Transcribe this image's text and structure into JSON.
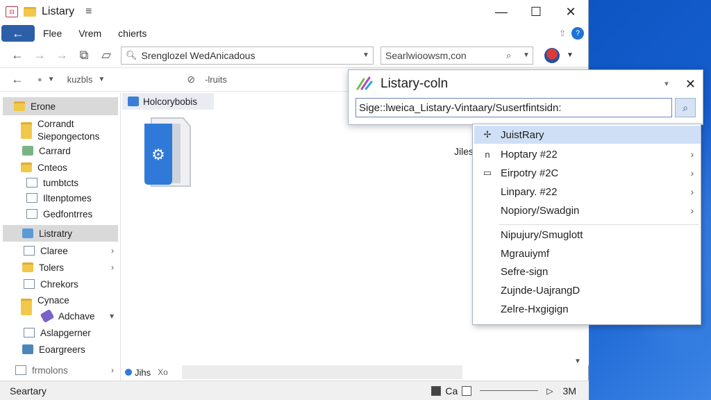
{
  "window": {
    "title": "Listary",
    "menu_glyph": "≡",
    "minimize": "—",
    "maximize": "☐",
    "close": "✕"
  },
  "menubar": {
    "items": [
      "Flee",
      "Vrem",
      "chierts"
    ]
  },
  "address": {
    "path": "Srenglozel WedAnicadous",
    "search_placeholder": "Searlwioowsm,con"
  },
  "toolbar2": {
    "label1": "kuzbls",
    "label2": "-lruits"
  },
  "sidebar": {
    "items": [
      {
        "label": "Erone"
      },
      {
        "label": "Corrandt"
      },
      {
        "label": "Siepongectons"
      },
      {
        "label": "Carrard"
      },
      {
        "label": "Cnteos"
      },
      {
        "label": "tumbtcts"
      },
      {
        "label": "Iltenptomes"
      },
      {
        "label": "Gedfontrres"
      },
      {
        "label": "Listratry"
      },
      {
        "label": "Claree"
      },
      {
        "label": "Tolers"
      },
      {
        "label": "Chrekors"
      },
      {
        "label": "Cynace"
      },
      {
        "label": "Adchave"
      },
      {
        "label": "Aslapgerner"
      },
      {
        "label": "Eoargreers"
      },
      {
        "label": "frmolons"
      }
    ]
  },
  "content": {
    "column_header": "Holcorybobis",
    "file_label": "Jiles"
  },
  "hbar": {
    "tab1": "Jihs",
    "tab2": "Xo"
  },
  "status": {
    "left": "Seartary",
    "view_label": "Ca",
    "zoom": "3M"
  },
  "listary": {
    "title": "Listary-coln",
    "query": "Sige::lweica_Listary-Vintaary/Susertfintsidn:",
    "items": [
      {
        "label": "JuistRary",
        "lead": "✢",
        "arrow": false
      },
      {
        "label": "Hoptary #22",
        "lead": "n",
        "arrow": true
      },
      {
        "label": "Eirpotry #2C",
        "lead": "▭",
        "arrow": true
      },
      {
        "label": "Linpary. #22",
        "lead": "",
        "arrow": true
      },
      {
        "label": "Nopiory/Swadgin",
        "lead": "",
        "arrow": true
      },
      {
        "label": "Nipujury/Smuglott",
        "lead": "",
        "arrow": false
      },
      {
        "label": "Mgrauiymf",
        "lead": "",
        "arrow": false
      },
      {
        "label": "Sefre-sign",
        "lead": "",
        "arrow": false
      },
      {
        "label": "Zujnde-UajrangD",
        "lead": "",
        "arrow": false
      },
      {
        "label": "Zelre-Hxgigign",
        "lead": "",
        "arrow": false
      }
    ]
  },
  "colors": {
    "accent": "#2c5fa8",
    "highlight": "#cfe0f6",
    "desktop": "#0a57c8"
  }
}
